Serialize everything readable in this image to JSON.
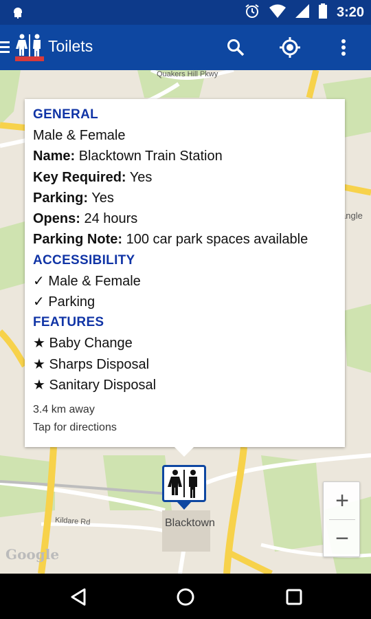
{
  "status_bar": {
    "time": "3:20",
    "icons": [
      "android-icon",
      "alarm-icon",
      "wifi-icon",
      "signal-icon",
      "battery-icon"
    ]
  },
  "app_bar": {
    "title": "Toilets",
    "icons": [
      "menu-icon",
      "toilet-logo-icon",
      "search-icon",
      "my-location-icon",
      "overflow-menu-icon"
    ]
  },
  "info_window": {
    "general_heading": "GENERAL",
    "type": "Male & Female",
    "fields": [
      {
        "label": "Name:",
        "value": "Blacktown Train Station"
      },
      {
        "label": "Key Required:",
        "value": "Yes"
      },
      {
        "label": "Parking:",
        "value": "Yes"
      },
      {
        "label": "Opens:",
        "value": "24 hours"
      },
      {
        "label": "Parking Note:",
        "value": "100 car park spaces available"
      }
    ],
    "accessibility_heading": "ACCESSIBILITY",
    "accessibility_items": [
      "✓ Male & Female",
      "✓ Parking"
    ],
    "features_heading": "FEATURES",
    "features_items": [
      "★ Baby Change",
      "★ Sharps Disposal",
      "★ Sanitary Disposal"
    ],
    "distance": "3.4 km away",
    "directions_hint": "Tap for directions"
  },
  "map": {
    "place_label": "Blacktown",
    "street_label_1": "Quakers Hill Pkwy",
    "street_label_2": "Kildare Rd",
    "edge_label": "angle",
    "attribution": "Google",
    "zoom_in_label": "+",
    "zoom_out_label": "−"
  },
  "colors": {
    "app_bar": "#0e47a1",
    "status_bar": "#0d3a8a",
    "section_heading": "#1034a6",
    "map_bg": "#ece7dc",
    "road_major": "#f7d24b",
    "park": "#cfe3b0"
  },
  "nav_bar": {
    "icons": [
      "back-icon",
      "home-icon",
      "recents-icon"
    ]
  }
}
